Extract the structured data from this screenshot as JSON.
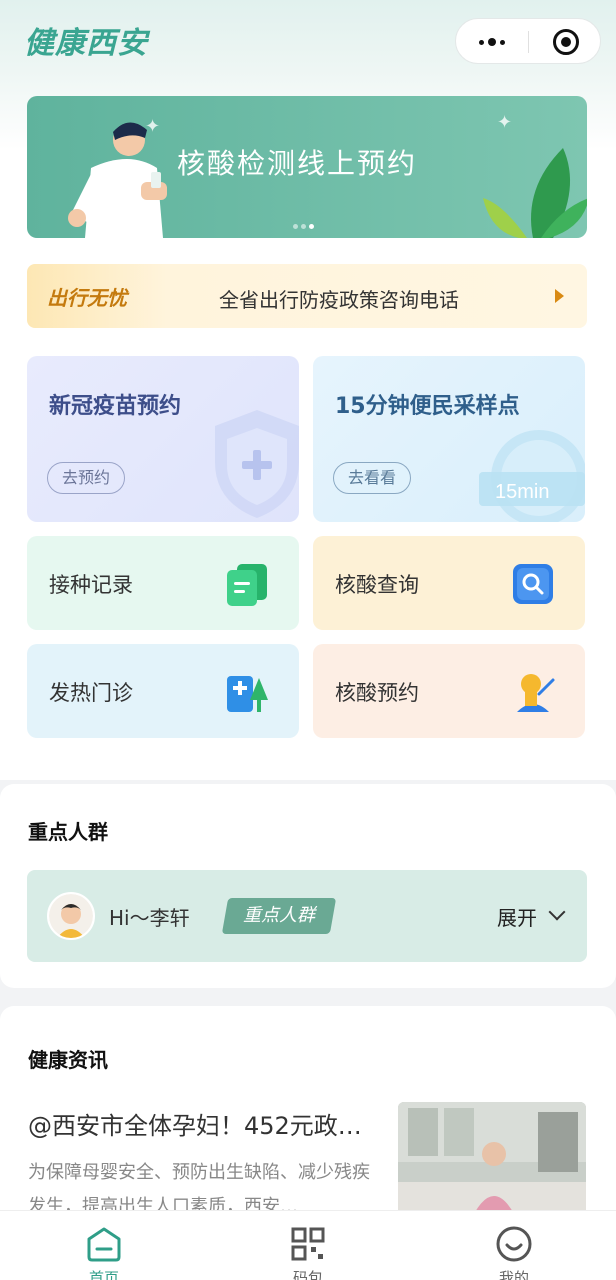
{
  "colors": {
    "brand": "#3aa591",
    "banner": "#5fb39d",
    "notice_accent": "#c47a0e",
    "tab_active": "#2f9e88"
  },
  "header": {
    "app_title": "健康西安",
    "more_icon": "more-dots-icon",
    "close_icon": "close-mini-program-icon"
  },
  "banner": {
    "title": "核酸检测线上预约",
    "page_count": 3,
    "active_page": 3
  },
  "notice": {
    "tag": "出行无忧",
    "text": "全省出行防疫政策咨询电话"
  },
  "services": {
    "vaccine": {
      "title": "新冠疫苗预约",
      "action": "去预约"
    },
    "sampling": {
      "title": "15分钟便民采样点",
      "action": "去看看",
      "badge": "15min"
    },
    "record": {
      "label": "接种记录"
    },
    "nucleic_query": {
      "label": "核酸查询"
    },
    "fever_clinic": {
      "label": "发热门诊"
    },
    "nucleic_booking": {
      "label": "核酸预约"
    }
  },
  "key_group": {
    "section_title": "重点人群",
    "greeting": "Hi～李轩",
    "tag": "重点人群",
    "expand_label": "展开"
  },
  "news": {
    "section_title": "健康资讯",
    "items": [
      {
        "title": "@西安市全体孕妇！452元政…",
        "summary": "为保障母婴安全、预防出生缺陷、减少残疾发生，提高出生人口素质，西安…"
      }
    ]
  },
  "tabbar": {
    "items": [
      {
        "label": "首页",
        "active": true
      },
      {
        "label": "码包",
        "active": false
      },
      {
        "label": "我的",
        "active": false
      }
    ]
  }
}
